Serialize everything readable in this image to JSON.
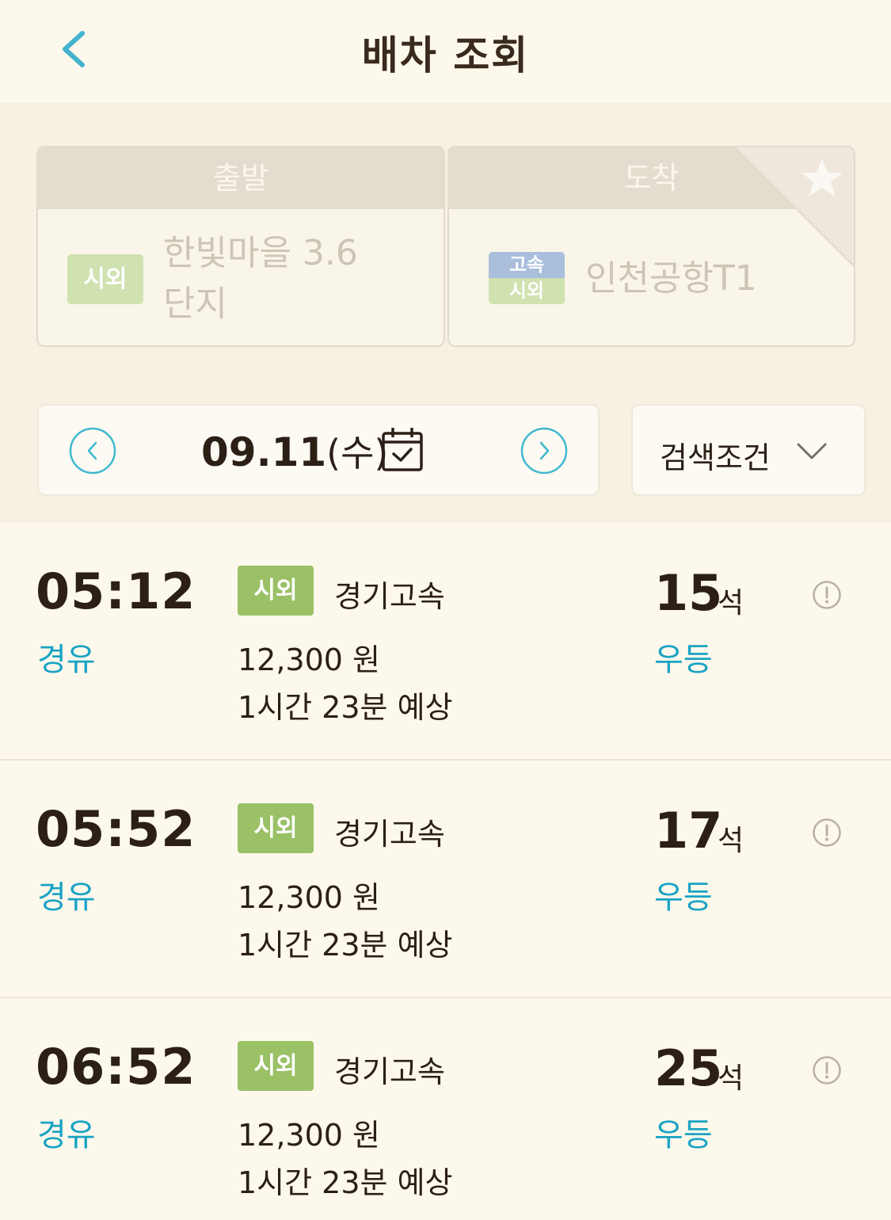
{
  "header": {
    "title": "배차 조회"
  },
  "route": {
    "departure": {
      "header": "출발",
      "tag": "시외",
      "station": "한빛마을 3.6단지"
    },
    "arrival": {
      "header": "도착",
      "tag_top": "고속",
      "tag_bottom": "시외",
      "station": "인천공항T1"
    }
  },
  "date": {
    "value": "09.11",
    "day": "(수)"
  },
  "filter": {
    "label": "검색조건"
  },
  "schedules": [
    {
      "time": "05:12",
      "via": "경유",
      "type": "시외",
      "company": "경기고속",
      "price": "12,300 원",
      "duration": "1시간 23분 예상",
      "seats": "15",
      "seat_unit": "석",
      "grade": "우등"
    },
    {
      "time": "05:52",
      "via": "경유",
      "type": "시외",
      "company": "경기고속",
      "price": "12,300 원",
      "duration": "1시간 23분 예상",
      "seats": "17",
      "seat_unit": "석",
      "grade": "우등"
    },
    {
      "time": "06:52",
      "via": "경유",
      "type": "시외",
      "company": "경기고속",
      "price": "12,300 원",
      "duration": "1시간 23분 예상",
      "seats": "25",
      "seat_unit": "석",
      "grade": "우등"
    }
  ],
  "colors": {
    "accent": "#1aa3c4",
    "badge": "#9ac166",
    "background": "#fdf8ec"
  },
  "icons": {
    "back": "chevron-left-icon",
    "favorite": "star-icon",
    "calendar": "calendar-icon",
    "info": "info-icon"
  }
}
